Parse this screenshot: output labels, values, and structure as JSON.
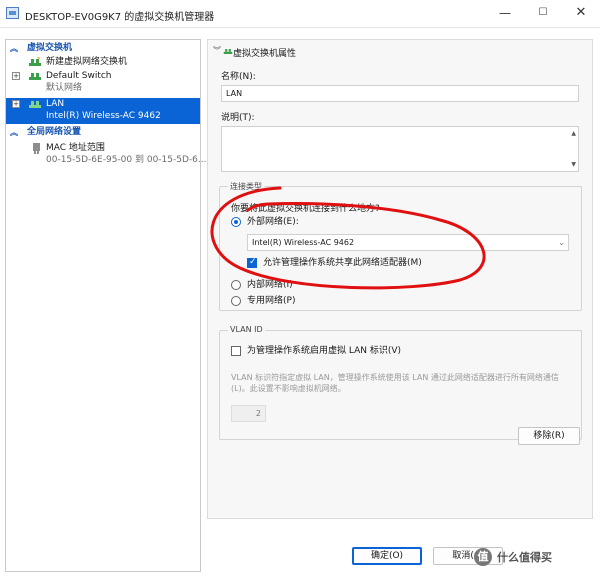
{
  "window": {
    "title": "DESKTOP-EV0G9K7 的虚拟交换机管理器",
    "minimize_glyph": "—",
    "maximize_glyph": "☐",
    "close_glyph": "✕"
  },
  "left_pane": {
    "section_switches": "虚拟交换机",
    "new_switch": "新建虚拟网络交换机",
    "default_switch": {
      "name": "Default Switch",
      "sub": "默认网络"
    },
    "lan": {
      "name": "LAN",
      "sub": "Intel(R) Wireless-AC 9462"
    },
    "section_global": "全局网络设置",
    "mac_range": {
      "name": "MAC 地址范围",
      "sub": "00-15-5D-6E-95-00 到 00-15-5D-6..."
    }
  },
  "properties": {
    "header": "虚拟交换机属性",
    "name_label": "名称(N):",
    "name_value": "LAN",
    "notes_label": "说明(T):",
    "connection_type_label": "连接类型",
    "question": "你要将此虚拟交换机连接到什么地方?",
    "external_label": "外部网络(E):",
    "adapter_value": "Intel(R) Wireless-AC 9462",
    "allow_share_label": "允许管理操作系统共享此网络适配器(M)",
    "internal_label": "内部网络(I)",
    "private_label": "专用网络(P)",
    "vlan_label": "VLAN ID",
    "vlan_enable_label": "为管理操作系统启用虚拟 LAN 标识(V)",
    "vlan_desc": "VLAN 标识符指定虚拟 LAN，管理操作系统使用该 LAN 通过此网络适配器进行所有网络通信(L)。此设置不影响虚拟机网络。",
    "vlan_id_value": "2",
    "remove_button": "移除(R)"
  },
  "footer": {
    "ok_button": "确定(O)",
    "cancel_button": "取消(C)"
  },
  "watermark": {
    "text": "什么值得买",
    "logo_glyph": "值"
  },
  "colors": {
    "accent": "#0a64d6",
    "annotation": "#e01010",
    "section_header": "#1a56b0"
  }
}
